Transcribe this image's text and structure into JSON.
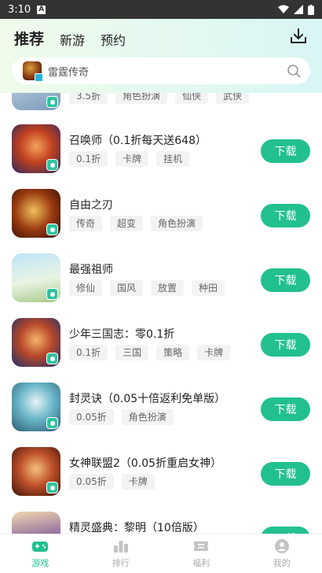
{
  "status_bar": {
    "time": "3:10",
    "notif": "A"
  },
  "top_tabs": [
    "推荐",
    "新游",
    "预约"
  ],
  "search": {
    "placeholder": "雷霆传奇"
  },
  "partial_row": {
    "tags": [
      "3.5折",
      "角色扮演",
      "仙侠",
      "武侠"
    ]
  },
  "games": [
    {
      "title": "召唤师（0.1折每天送648）",
      "tags": [
        "0.1折",
        "卡牌",
        "挂机"
      ],
      "button": "下载"
    },
    {
      "title": "自由之刃",
      "tags": [
        "传奇",
        "超变",
        "角色扮演"
      ],
      "button": "下载"
    },
    {
      "title": "最强祖师",
      "tags": [
        "修仙",
        "国风",
        "放置",
        "种田"
      ],
      "button": "下载"
    },
    {
      "title": "少年三国志：零0.1折",
      "tags": [
        "0.1折",
        "三国",
        "策略",
        "卡牌"
      ],
      "button": "下载"
    },
    {
      "title": "封灵诀（0.05十倍返利免单版）",
      "tags": [
        "0.05折",
        "角色扮演"
      ],
      "button": "下载"
    },
    {
      "title": "女神联盟2（0.05折重启女神）",
      "tags": [
        "0.05折",
        "卡牌"
      ],
      "button": "下载"
    },
    {
      "title": "精灵盛典：黎明（10倍版）",
      "tags": [],
      "button": "下载"
    }
  ],
  "bottom_nav": [
    {
      "label": "游戏",
      "icon": "gamepad-icon"
    },
    {
      "label": "排行",
      "icon": "ranking-icon"
    },
    {
      "label": "福利",
      "icon": "ticket-icon"
    },
    {
      "label": "我的",
      "icon": "user-icon"
    }
  ],
  "colors": {
    "accent": "#22c08f",
    "status_bar": "#333333"
  }
}
